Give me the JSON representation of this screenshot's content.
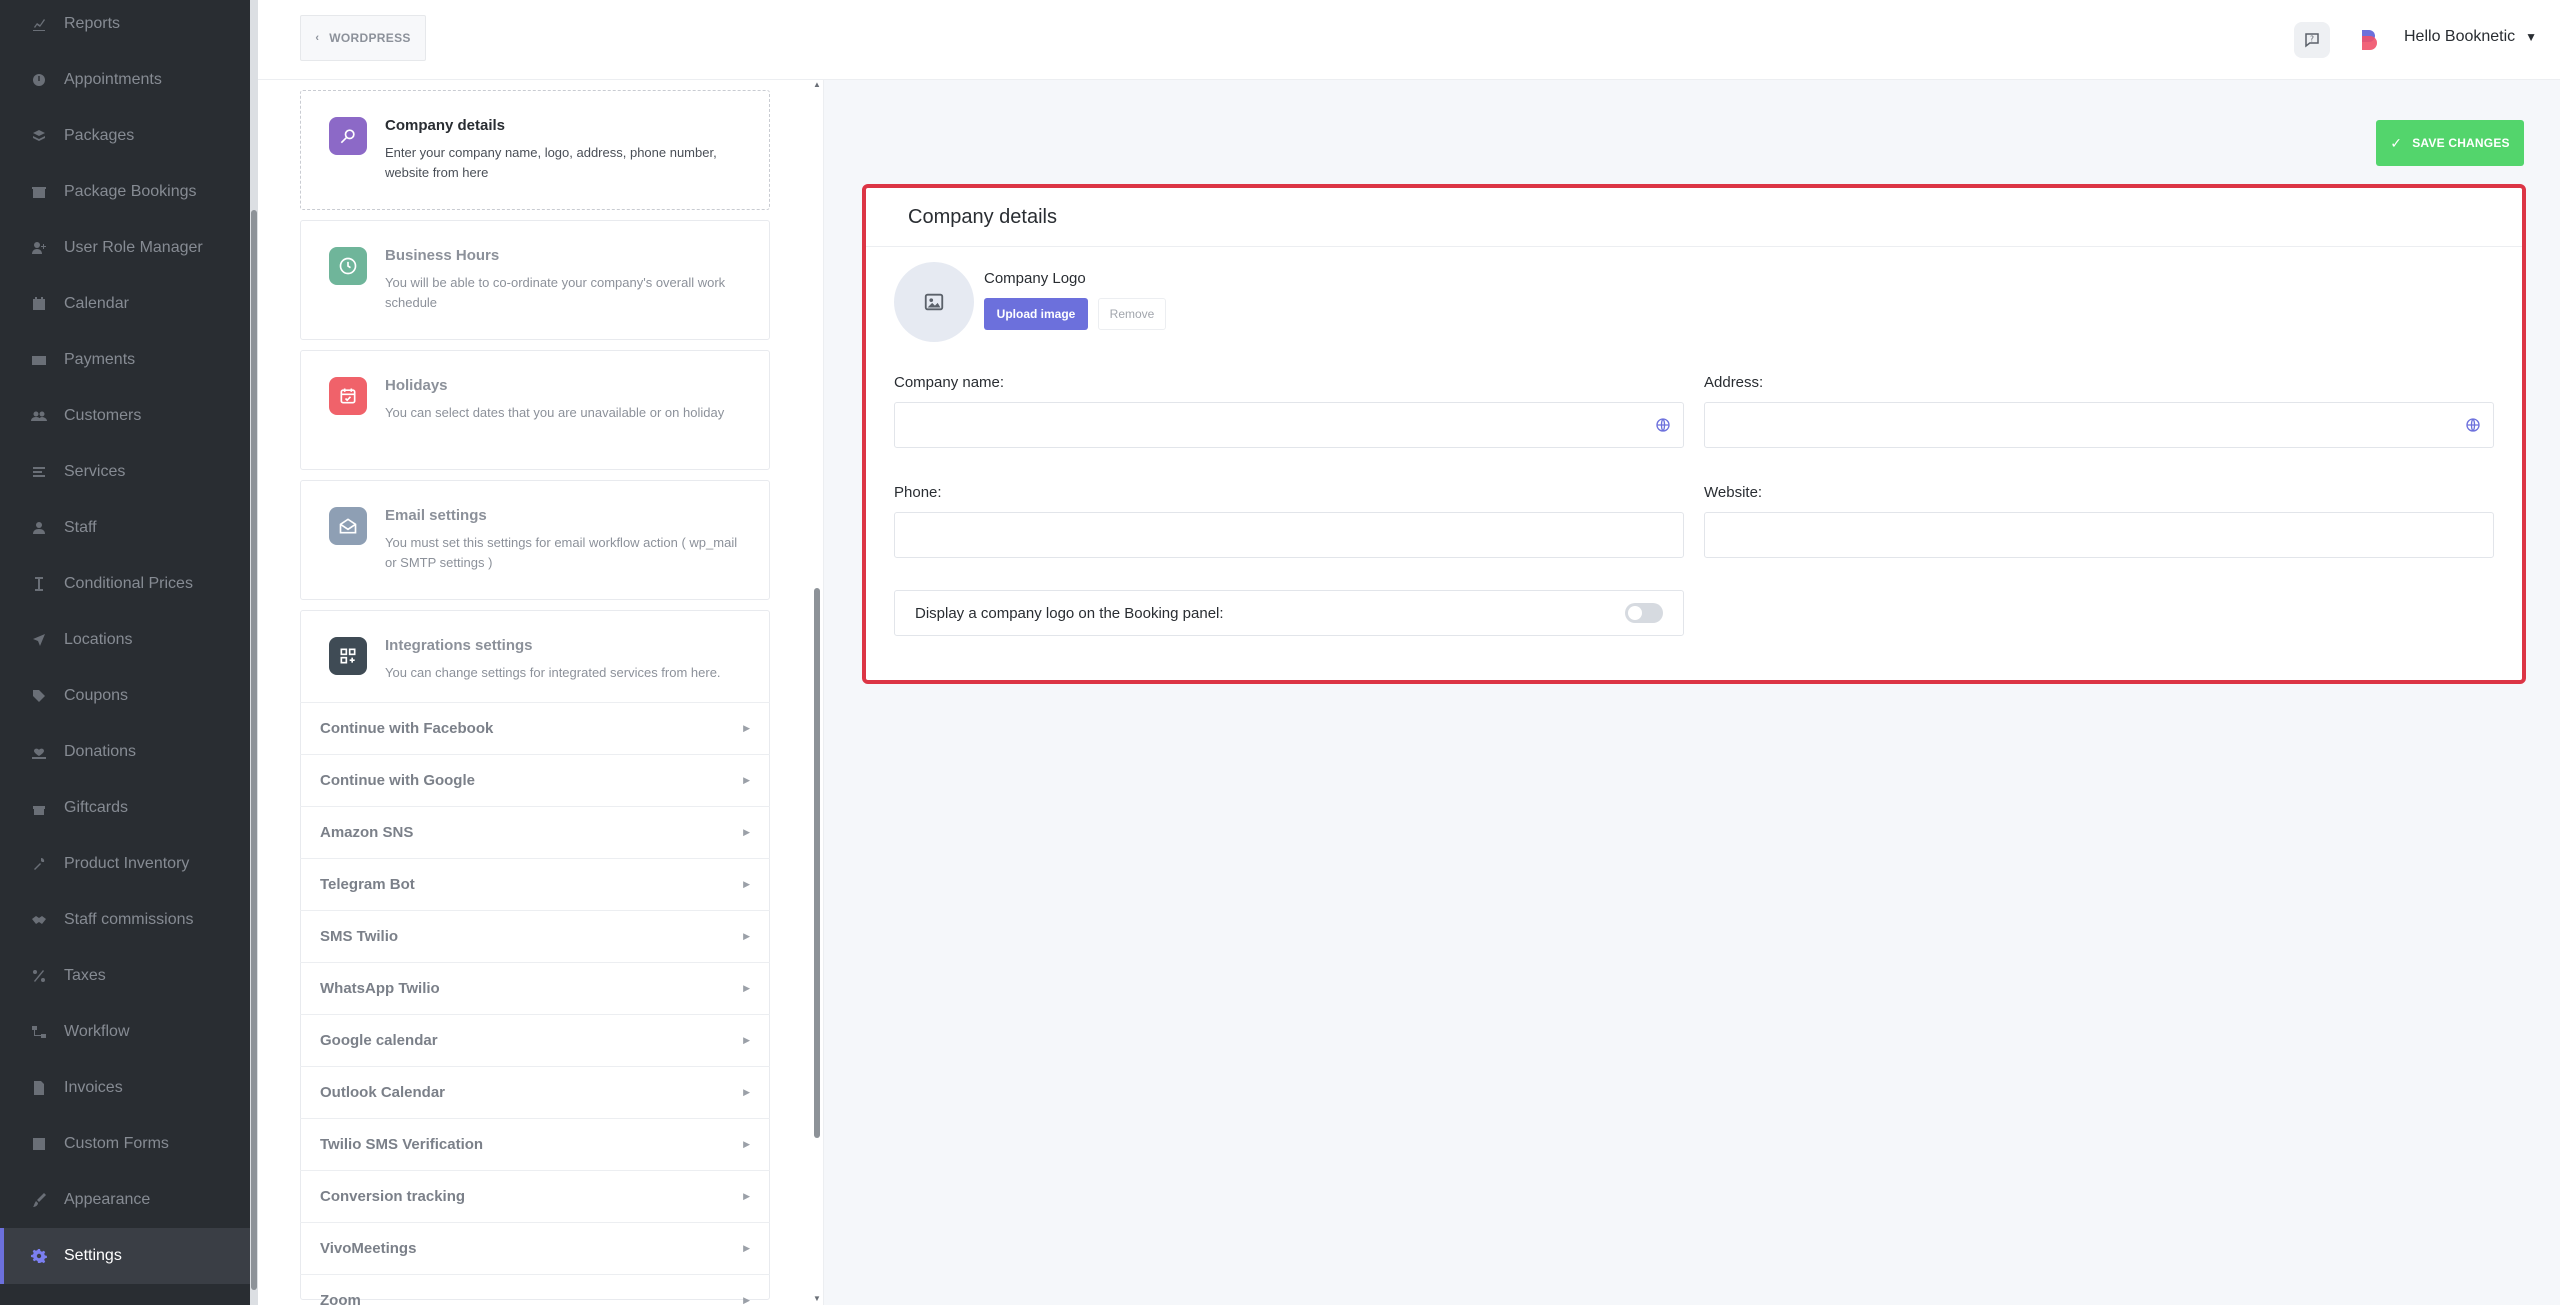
{
  "sidebar": {
    "items": [
      {
        "label": "Reports",
        "icon": "chart-line-icon"
      },
      {
        "label": "Appointments",
        "icon": "clock-icon"
      },
      {
        "label": "Packages",
        "icon": "layers-icon"
      },
      {
        "label": "Package Bookings",
        "icon": "box-icon"
      },
      {
        "label": "User Role Manager",
        "icon": "user-plus-icon"
      },
      {
        "label": "Calendar",
        "icon": "calendar-icon"
      },
      {
        "label": "Payments",
        "icon": "credit-card-icon"
      },
      {
        "label": "Customers",
        "icon": "users-icon"
      },
      {
        "label": "Services",
        "icon": "list-icon"
      },
      {
        "label": "Staff",
        "icon": "user-icon"
      },
      {
        "label": "Conditional Prices",
        "icon": "cursor-icon"
      },
      {
        "label": "Locations",
        "icon": "location-arrow-icon"
      },
      {
        "label": "Coupons",
        "icon": "tag-icon"
      },
      {
        "label": "Donations",
        "icon": "hand-heart-icon"
      },
      {
        "label": "Giftcards",
        "icon": "gift-icon"
      },
      {
        "label": "Product Inventory",
        "icon": "tools-icon"
      },
      {
        "label": "Staff commissions",
        "icon": "handshake-icon"
      },
      {
        "label": "Taxes",
        "icon": "percent-icon"
      },
      {
        "label": "Workflow",
        "icon": "workflow-icon"
      },
      {
        "label": "Invoices",
        "icon": "file-icon"
      },
      {
        "label": "Custom Forms",
        "icon": "form-icon"
      },
      {
        "label": "Appearance",
        "icon": "brush-icon"
      },
      {
        "label": "Settings",
        "icon": "gear-icon"
      }
    ],
    "active_index": 22
  },
  "topbar": {
    "back_label": "WORDPRESS",
    "user_greeting": "Hello Booknetic"
  },
  "settings_menu": {
    "cards": [
      {
        "title": "Company details",
        "desc": "Enter your company name, logo, address, phone number, website from here",
        "color": "#8c69c7"
      },
      {
        "title": "Business Hours",
        "desc": "You will be able to co-ordinate your company's overall work schedule",
        "color": "#6fb59a"
      },
      {
        "title": "Holidays",
        "desc": "You can select dates that you are unavailable or on holiday",
        "color": "#f0626a"
      },
      {
        "title": "Email settings",
        "desc": "You must set this settings for email workflow action ( wp_mail or SMTP settings )",
        "color": "#8e9fb4"
      },
      {
        "title": "Integrations settings",
        "desc": "You can change settings for integrated services from here.",
        "color": "#3f4b55"
      }
    ],
    "integrations": [
      "Continue with Facebook",
      "Continue with Google",
      "Amazon SNS",
      "Telegram Bot",
      "SMS Twilio",
      "WhatsApp Twilio",
      "Google calendar",
      "Outlook Calendar",
      "Twilio SMS Verification",
      "Conversion tracking",
      "VivoMeetings",
      "Zoom"
    ]
  },
  "main": {
    "save_label": "SAVE CHANGES",
    "panel_title": "Company details",
    "logo_label": "Company Logo",
    "upload_label": "Upload image",
    "remove_label": "Remove",
    "fields": {
      "company_name_label": "Company name:",
      "company_name_value": "",
      "address_label": "Address:",
      "address_value": "",
      "phone_label": "Phone:",
      "phone_value": "",
      "website_label": "Website:",
      "website_value": ""
    },
    "toggle_label": "Display a company logo on the Booking panel:",
    "toggle_on": false
  },
  "colors": {
    "accent": "#6c70dc",
    "save": "#53d56c",
    "highlight_border": "#dc3545"
  }
}
